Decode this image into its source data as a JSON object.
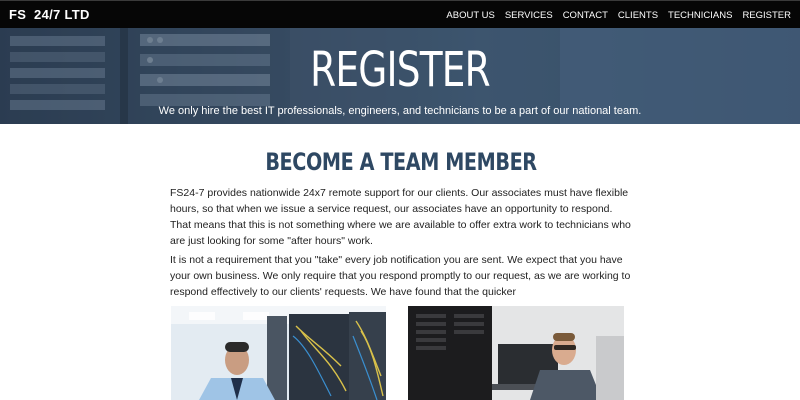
{
  "navbar": {
    "brand": "FS  24/7 LTD",
    "links": [
      "ABOUT US",
      "SERVICES",
      "CONTACT",
      "CLIENTS",
      "TECHNICIANS",
      "REGISTER"
    ]
  },
  "hero": {
    "title": "REGISTER",
    "subtitle": "We only hire the best IT professionals, engineers, and technicians to be a part of our national team."
  },
  "main": {
    "heading": "BECOME A TEAM MEMBER",
    "paragraphs": [
      "FS24-7 provides nationwide 24x7 remote support for our clients. Our associates must have flexible hours, so that when we issue a service request, our associates have an opportunity to respond. That means that this is not something where we are available to offer extra work to technicians who are just looking for some \"after hours\" work.",
      "It is not a requirement that you \"take\" every job notification you are sent. We expect that you have your own business. We only require that you respond promptly to our request, as we are working to respond effectively to our clients' requests. We have found that the quicker"
    ]
  },
  "colors": {
    "navbar_bg": "#060606",
    "hero_bg": "#3a4e66",
    "heading": "#2e4863",
    "body_text": "#222222"
  }
}
